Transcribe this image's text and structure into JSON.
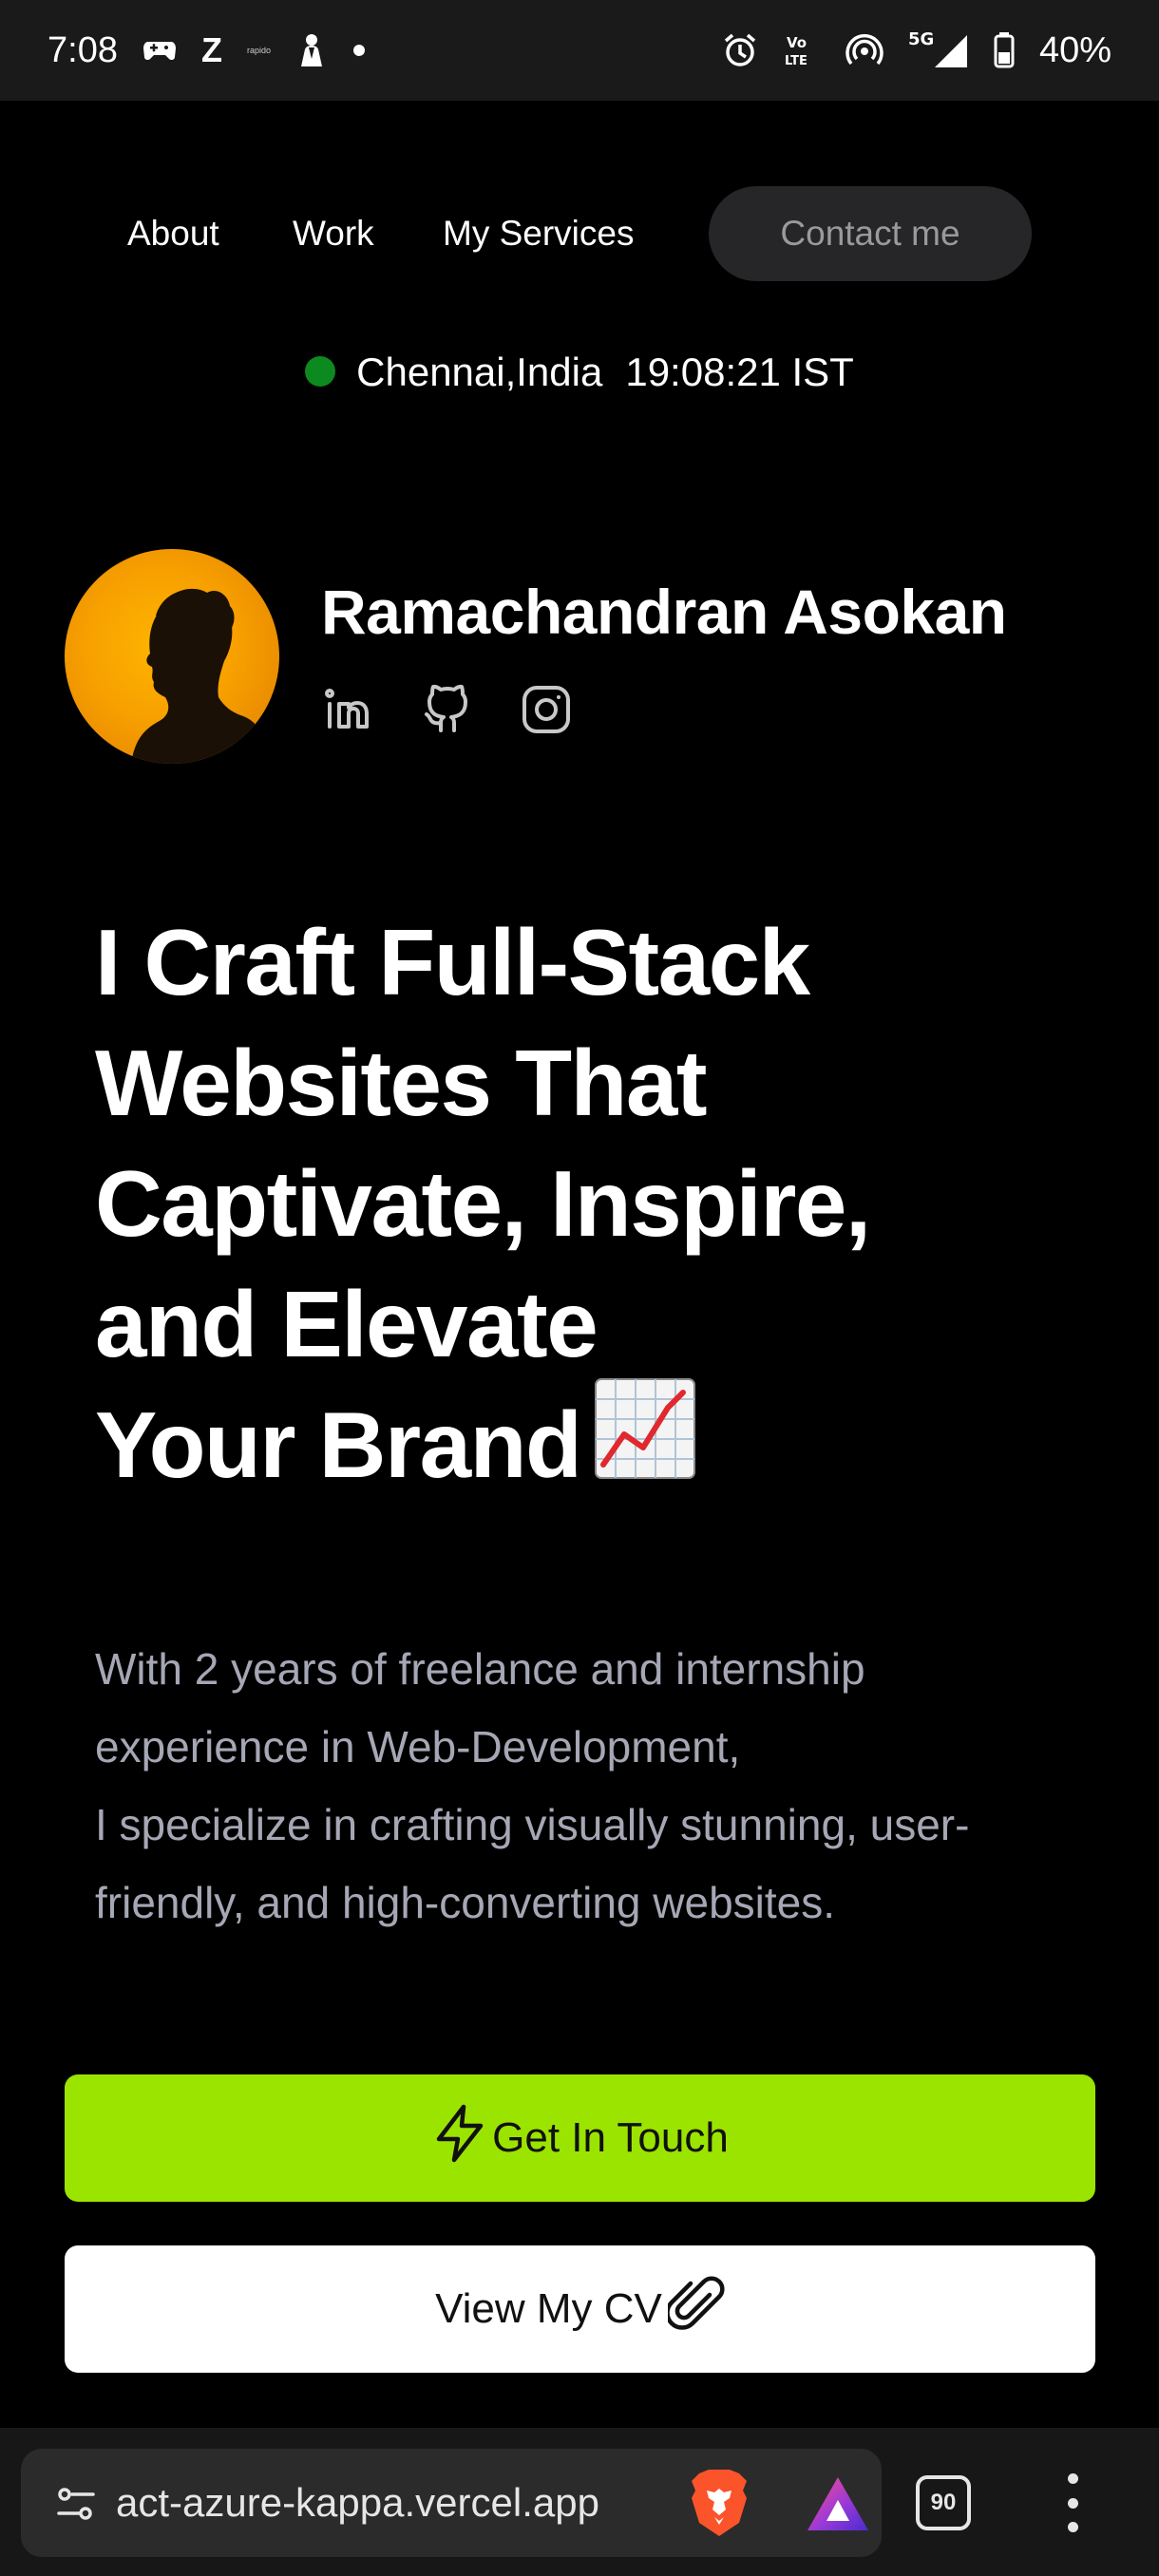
{
  "status_bar": {
    "time": "7:08",
    "notif_z": "Z",
    "notif_rapido": "rapido",
    "network": "5G",
    "battery": "40%"
  },
  "nav": {
    "about": "About",
    "work": "Work",
    "services": "My Services",
    "contact": "Contact me"
  },
  "location": {
    "place": "Chennai,India",
    "time": "19:08:21 IST",
    "status_color": "#0d8a1f"
  },
  "profile": {
    "name": "Ramachandran Asokan",
    "socials": [
      "linkedin-icon",
      "github-icon",
      "instagram-icon"
    ]
  },
  "hero": {
    "line1": "I Craft Full-Stack",
    "line2": "Websites That",
    "line3": "Captivate, Inspire,",
    "line4": "and Elevate",
    "line5": "Your Brand",
    "emoji": "chart-increasing-icon"
  },
  "intro": {
    "line1": "With 2 years of freelance and internship",
    "line2": "experience in Web-Development,",
    "line3": "I specialize in crafting visually stunning, user-",
    "line4": "friendly, and high-converting websites."
  },
  "buttons": {
    "get_in_touch": "Get In Touch",
    "view_cv": "View My CV",
    "accent_color": "#9be400"
  },
  "browser": {
    "url": "act-azure-kappa.vercel.app",
    "tab_count": "90"
  }
}
